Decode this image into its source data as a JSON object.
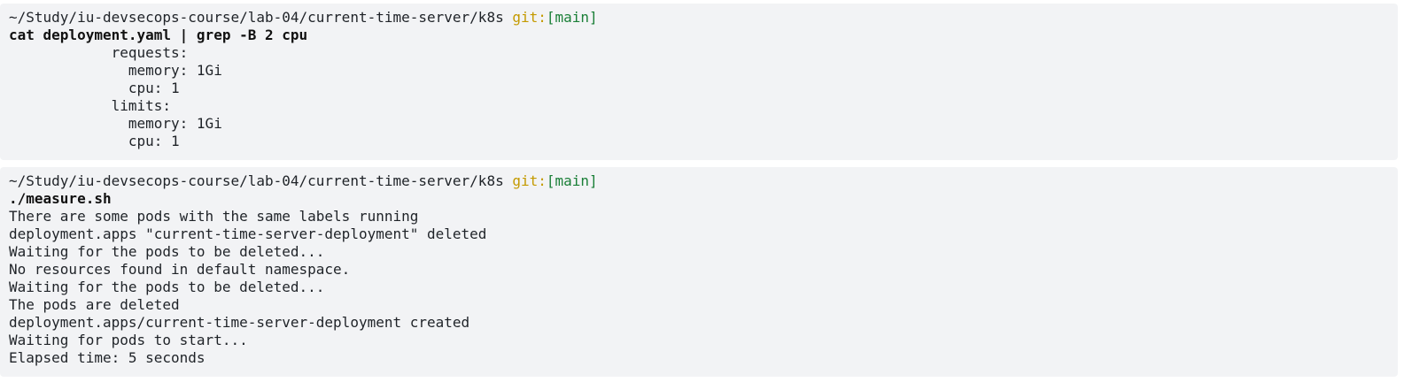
{
  "colors": {
    "background": "#f2f3f5",
    "text": "#1f2328",
    "git_label": "#c49a00",
    "branch": "#1a7f37"
  },
  "blocks": [
    {
      "prompt": {
        "path": "~/Study/iu-devsecops-course/lab-04/current-time-server/k8s",
        "git_label": "git:",
        "branch": "[main]"
      },
      "command": "cat deployment.yaml | grep -B 2 cpu",
      "output": [
        "            requests:",
        "              memory: 1Gi",
        "              cpu: 1",
        "            limits:",
        "              memory: 1Gi",
        "              cpu: 1"
      ]
    },
    {
      "prompt": {
        "path": "~/Study/iu-devsecops-course/lab-04/current-time-server/k8s",
        "git_label": "git:",
        "branch": "[main]"
      },
      "command": "./measure.sh",
      "output": [
        "There are some pods with the same labels running",
        "deployment.apps \"current-time-server-deployment\" deleted",
        "Waiting for the pods to be deleted...",
        "No resources found in default namespace.",
        "Waiting for the pods to be deleted...",
        "The pods are deleted",
        "deployment.apps/current-time-server-deployment created",
        "Waiting for pods to start...",
        "Elapsed time: 5 seconds"
      ]
    }
  ]
}
